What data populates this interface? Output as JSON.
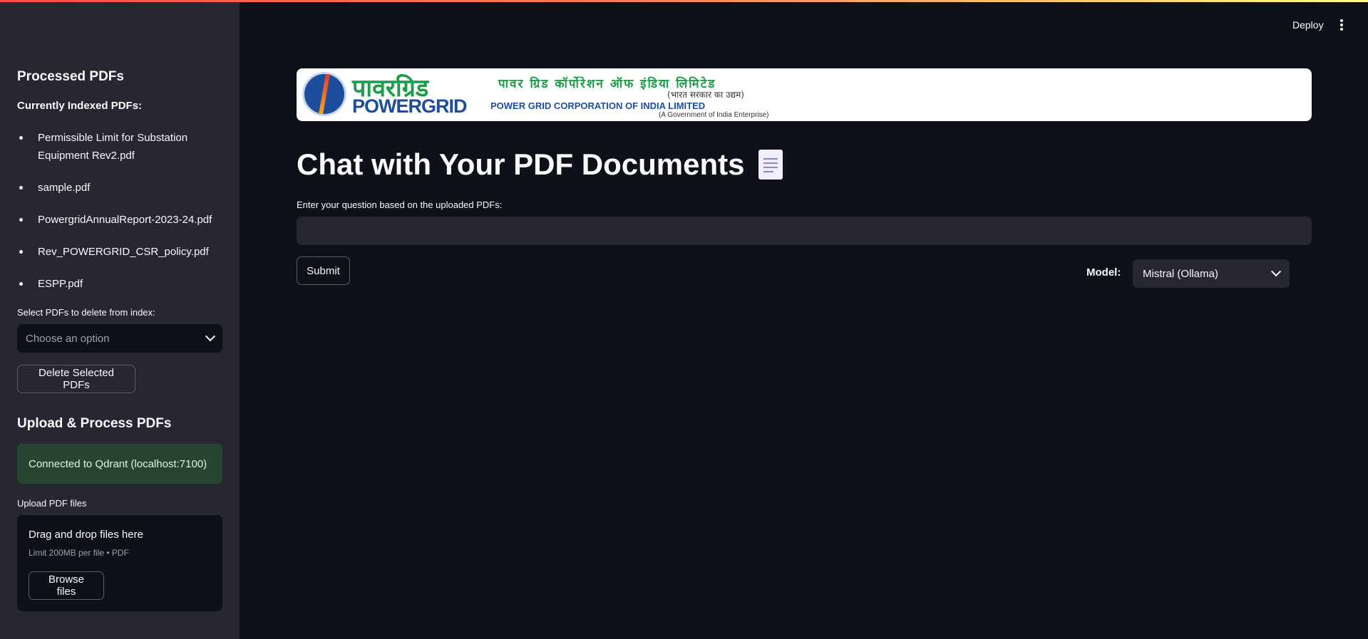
{
  "header": {
    "deploy_label": "Deploy"
  },
  "sidebar": {
    "processed_title": "Processed PDFs",
    "indexed_heading": "Currently Indexed PDFs:",
    "pdfs": [
      "Permissible Limit for Substation Equipment Rev2.pdf",
      "sample.pdf",
      "PowergridAnnualReport-2023-24.pdf",
      "Rev_POWERGRID_CSR_policy.pdf",
      "ESPP.pdf"
    ],
    "delete_label": "Select PDFs to delete from index:",
    "delete_placeholder": "Choose an option",
    "delete_button": "Delete Selected PDFs",
    "upload_title": "Upload & Process PDFs",
    "status_message": "Connected to Qdrant (localhost:7100)",
    "upload_label": "Upload PDF files",
    "dropzone_title": "Drag and drop files here",
    "dropzone_limit": "Limit 200MB per file • PDF",
    "browse_button": "Browse files"
  },
  "banner": {
    "hindi_brand": "पावरग्रिड",
    "english_brand": "POWERGRID",
    "hindi_full": "पावर ग्रिड कॉर्पोरेशन ऑफ इंडिया लिमिटेड",
    "hindi_sub": "(भारत सरकार का उद्यम)",
    "english_full": "POWER GRID CORPORATION OF INDIA LIMITED",
    "english_sub": "(A Government of India Enterprise)"
  },
  "main": {
    "title": "Chat with Your PDF Documents",
    "question_label": "Enter your question based on the uploaded PDFs:",
    "question_value": "",
    "submit_button": "Submit",
    "model_label": "Model:",
    "model_selected": "Mistral (Ollama)"
  },
  "colors": {
    "background": "#0e1117",
    "sidebar": "#262730",
    "success": "#274532",
    "brand_blue": "#1d4e9e",
    "brand_green": "#1a9c48"
  }
}
